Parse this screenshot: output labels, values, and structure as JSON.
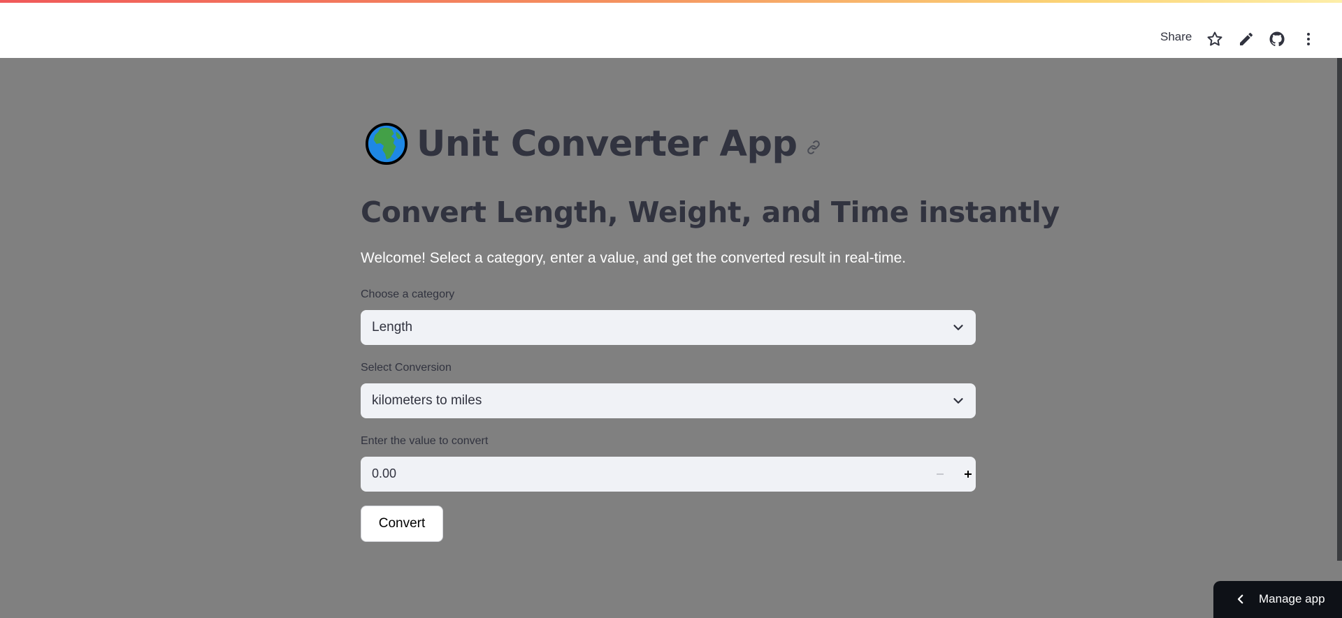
{
  "header": {
    "share_label": "Share",
    "icons": [
      "star-icon",
      "pencil-icon",
      "github-icon",
      "more-vertical-icon"
    ]
  },
  "page": {
    "title_emoji": "globe-africa-icon",
    "title": "Unit Converter App",
    "subtitle": "Convert Length, Weight, and Time instantly",
    "welcome": "Welcome! Select a category, enter a value, and get the converted result in real-time."
  },
  "category": {
    "label": "Choose a category",
    "value": "Length"
  },
  "conversion": {
    "label": "Select Conversion",
    "value": "kilometers to miles"
  },
  "value_input": {
    "label": "Enter the value to convert",
    "value": "0.00"
  },
  "convert_button": {
    "label": "Convert"
  },
  "manage_app": {
    "label": "Manage app"
  },
  "colors": {
    "header_bg": "#ffffff",
    "main_bg": "#808080",
    "text_dark": "#31333f",
    "input_bg": "#f0f2f6",
    "manage_bg": "#0e1117"
  }
}
